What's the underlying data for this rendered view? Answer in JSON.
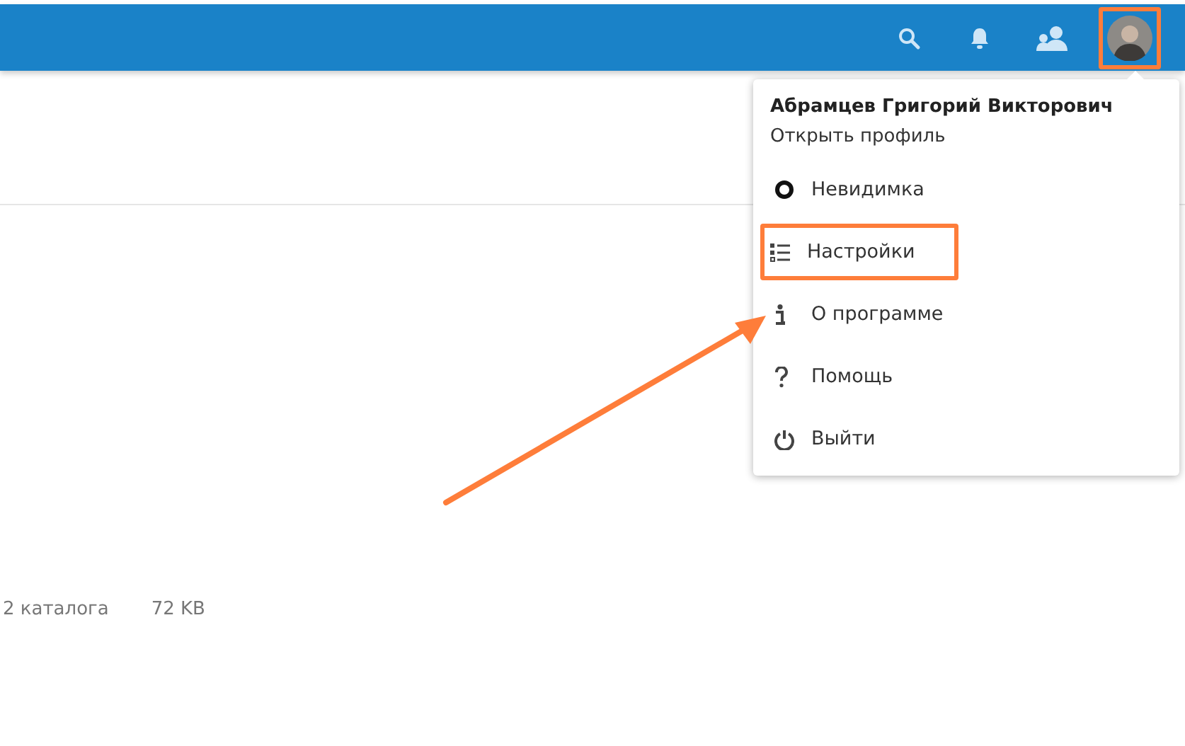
{
  "header": {
    "buttons": [
      {
        "kind": "search"
      },
      {
        "kind": "notifications"
      },
      {
        "kind": "contacts"
      }
    ],
    "avatar": {
      "highlighted": true
    }
  },
  "user_menu": {
    "user_name": "Абрамцев Григорий Викторович",
    "profile_link": "Открыть профиль",
    "items": [
      {
        "kind": "status",
        "label": "Невидимка",
        "highlighted": false
      },
      {
        "kind": "settings",
        "label": "Настройки",
        "highlighted": true
      },
      {
        "kind": "about",
        "label": "О программе",
        "highlighted": false
      },
      {
        "kind": "help",
        "label": "Помощь",
        "highlighted": false
      },
      {
        "kind": "logout",
        "label": "Выйти",
        "highlighted": false
      }
    ]
  },
  "summary": {
    "folders": "2 каталога",
    "size": "72 KB"
  },
  "annotation": {
    "arrow": true
  }
}
